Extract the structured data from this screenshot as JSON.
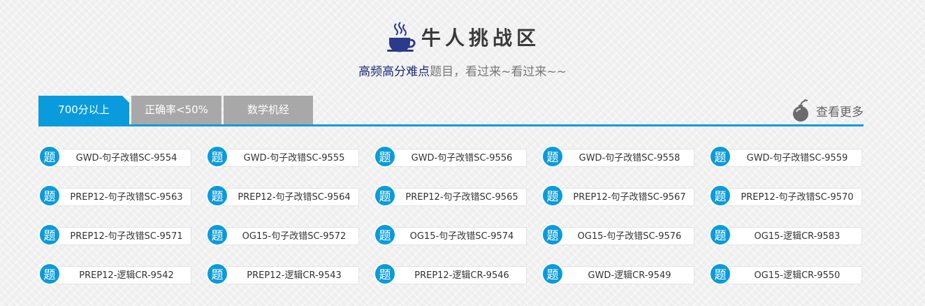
{
  "header": {
    "title": "牛人挑战区",
    "subtitle_highlight": "高频高分难点",
    "subtitle_rest": "题目，看过来~看过来~~"
  },
  "tabs": [
    {
      "label": "700分以上",
      "active": true
    },
    {
      "label": "正确率<50%",
      "active": false
    },
    {
      "label": "数学机经",
      "active": false
    }
  ],
  "more_label": "查看更多",
  "badge_char": "题",
  "questions": [
    [
      "GWD-句子改错SC-9554",
      "GWD-句子改错SC-9555",
      "GWD-句子改错SC-9556",
      "GWD-句子改错SC-9558",
      "GWD-句子改错SC-9559"
    ],
    [
      "PREP12-句子改错SC-9563",
      "PREP12-句子改错SC-9564",
      "PREP12-句子改错SC-9565",
      "PREP12-句子改错SC-9567",
      "PREP12-句子改错SC-9570"
    ],
    [
      "PREP12-句子改错SC-9571",
      "OG15-句子改错SC-9572",
      "OG15-句子改错SC-9574",
      "OG15-句子改错SC-9576",
      "OG15-逻辑CR-9583"
    ],
    [
      "PREP12-逻辑CR-9542",
      "PREP12-逻辑CR-9543",
      "PREP12-逻辑CR-9546",
      "GWD-逻辑CR-9549",
      "OG15-逻辑CR-9550"
    ]
  ],
  "colors": {
    "accent": "#0a9bdc",
    "inactive_tab": "#a8a8a8",
    "subtitle_highlight": "#1e2a78"
  },
  "icons": {
    "title": "coffee-cup-icon",
    "more": "bomb-icon",
    "badge": "question-badge-icon"
  }
}
